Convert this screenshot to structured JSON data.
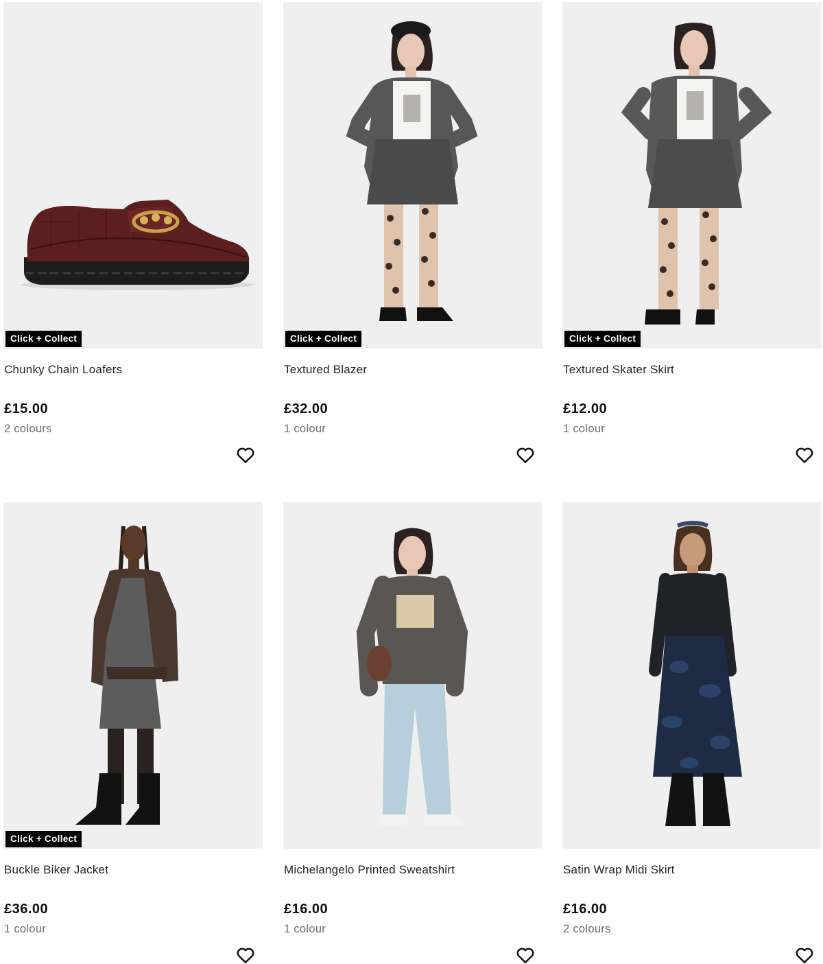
{
  "products": [
    {
      "title": "Chunky Chain Loafers",
      "price": "£15.00",
      "colours": "2 colours",
      "badge": "Click + Collect",
      "image": "burgundy-croc-loafer"
    },
    {
      "title": "Textured Blazer",
      "price": "£32.00",
      "colours": "1 colour",
      "badge": "Click + Collect",
      "image": "model-grey-blazer"
    },
    {
      "title": "Textured Skater Skirt",
      "price": "£12.00",
      "colours": "1 colour",
      "badge": "Click + Collect",
      "image": "model-grey-skater-skirt"
    },
    {
      "title": "Buckle Biker Jacket",
      "price": "£36.00",
      "colours": "1 colour",
      "badge": "Click + Collect",
      "image": "model-brown-biker-jacket"
    },
    {
      "title": "Michelangelo Printed Sweatshirt",
      "price": "£16.00",
      "colours": "1 colour",
      "badge": "",
      "image": "model-grey-printed-sweatshirt"
    },
    {
      "title": "Satin Wrap Midi Skirt",
      "price": "£16.00",
      "colours": "2 colours",
      "badge": "",
      "image": "model-navy-satin-skirt"
    }
  ],
  "icons": {
    "wishlist": "heart-outline-icon"
  },
  "colors": {
    "image_bg": "#efefef",
    "badge_bg": "#000000",
    "badge_text": "#ffffff",
    "title": "#222222",
    "price": "#111111",
    "secondary": "#6b6b6b"
  }
}
